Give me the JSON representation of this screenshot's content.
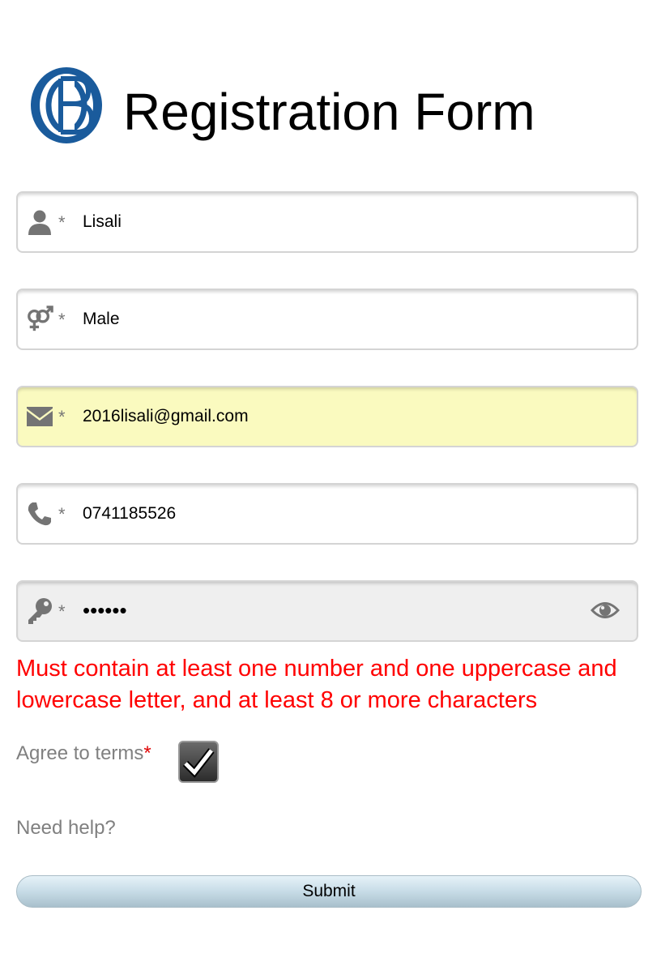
{
  "header": {
    "logo_letter": "B",
    "title": "Registration Form"
  },
  "fields": {
    "name": {
      "icon": "user-icon",
      "required_mark": "*",
      "value": "Lisali"
    },
    "gender": {
      "icon": "gender-icon",
      "required_mark": "*",
      "value": "Male"
    },
    "email": {
      "icon": "envelope-icon",
      "required_mark": "*",
      "value": "2016lisali@gmail.com"
    },
    "phone": {
      "icon": "phone-icon",
      "required_mark": "*",
      "value": "0741185526"
    },
    "password": {
      "icon": "key-icon",
      "required_mark": "*",
      "value": "••••••",
      "toggle_icon": "eye-icon"
    }
  },
  "password_error": "Must contain at least one number and one uppercase and lowercase letter, and at least 8 or more characters",
  "terms": {
    "label": "Agree to terms",
    "required_mark": "*",
    "checked": true
  },
  "help_text": "Need help?",
  "submit_label": "Submit",
  "colors": {
    "logo_blue": "#1a5b9c",
    "email_highlight": "#fafabf",
    "password_bg": "#efefef",
    "error": "#ff0000",
    "muted_text": "#808080"
  }
}
